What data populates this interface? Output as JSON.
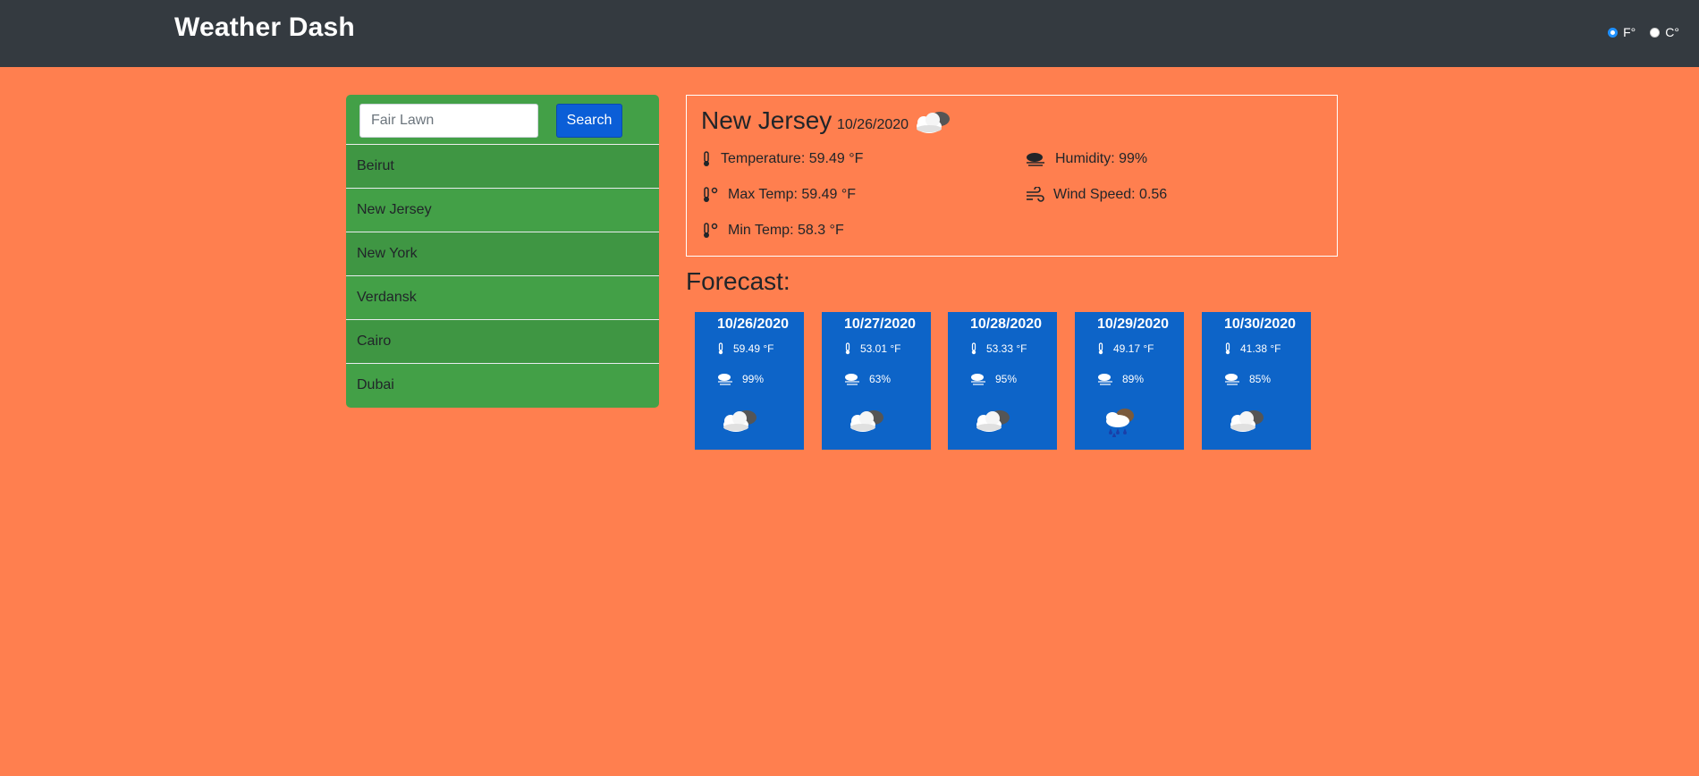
{
  "header": {
    "brand": "Weather Dash",
    "units": [
      {
        "label": "F°",
        "selected": true
      },
      {
        "label": "C°",
        "selected": false
      }
    ]
  },
  "sidebar": {
    "search_placeholder": "Fair Lawn",
    "search_value": "",
    "search_button": "Search",
    "cities": [
      "Beirut",
      "New Jersey",
      "New York",
      "Verdansk",
      "Cairo",
      "Dubai"
    ]
  },
  "current": {
    "city": "New Jersey",
    "date": "10/26/2020",
    "icon": "partly-cloudy-icon",
    "temperature": "Temperature: 59.49 °F",
    "max_temp": "Max Temp: 59.49 °F",
    "min_temp": "Min Temp: 58.3 °F",
    "humidity": "Humidity: 99%",
    "wind_speed": "Wind Speed: 0.56"
  },
  "forecast": {
    "title": "Forecast:",
    "days": [
      {
        "date": "10/26/2020",
        "temp": "59.49 °F",
        "humidity": "99%",
        "icon": "partly-cloudy-icon"
      },
      {
        "date": "10/27/2020",
        "temp": "53.01 °F",
        "humidity": "63%",
        "icon": "partly-cloudy-icon"
      },
      {
        "date": "10/28/2020",
        "temp": "53.33 °F",
        "humidity": "95%",
        "icon": "partly-cloudy-icon"
      },
      {
        "date": "10/29/2020",
        "temp": "49.17 °F",
        "humidity": "89%",
        "icon": "rain-icon"
      },
      {
        "date": "10/30/2020",
        "temp": "41.38 °F",
        "humidity": "85%",
        "icon": "partly-cloudy-icon"
      }
    ]
  },
  "colors": {
    "background": "#ff7f4f",
    "navbar": "#343a40",
    "sidebar": "#43a047",
    "forecast_card": "#0d64c8",
    "search_button": "#0b5ed7"
  }
}
